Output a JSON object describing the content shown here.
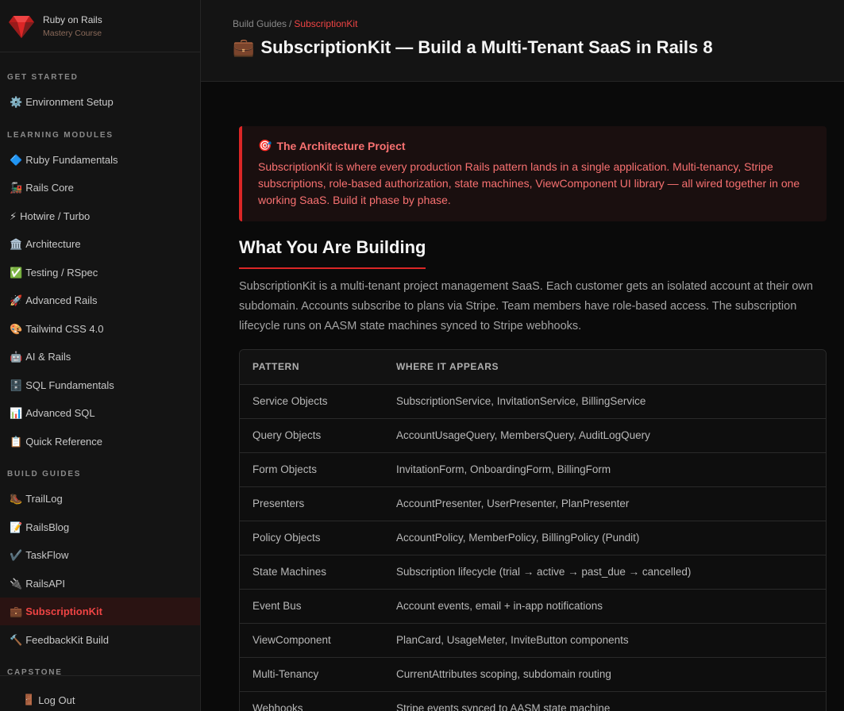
{
  "brand": {
    "title": "Ruby on Rails",
    "subtitle": "Mastery Course",
    "logo_icon": "ruby-gem-icon",
    "accent": "#dc2626"
  },
  "sidebar": {
    "sections": [
      {
        "label": "GET STARTED"
      },
      {
        "label": "LEARNING MODULES"
      },
      {
        "label": "BUILD GUIDES"
      },
      {
        "label": "CAPSTONE"
      }
    ],
    "items": [
      {
        "emoji": "⚙️",
        "label": "Environment Setup"
      },
      {
        "emoji": "🔷",
        "label": "Ruby Fundamentals"
      },
      {
        "emoji": "🚂",
        "label": "Rails Core"
      },
      {
        "emoji": "⚡",
        "label": "Hotwire / Turbo"
      },
      {
        "emoji": "🏛️",
        "label": "Architecture"
      },
      {
        "emoji": "✅",
        "label": "Testing / RSpec"
      },
      {
        "emoji": "🚀",
        "label": "Advanced Rails"
      },
      {
        "emoji": "🎨",
        "label": "Tailwind CSS 4.0"
      },
      {
        "emoji": "🤖",
        "label": "AI & Rails"
      },
      {
        "emoji": "🗄️",
        "label": "SQL Fundamentals"
      },
      {
        "emoji": "📊",
        "label": "Advanced SQL"
      },
      {
        "emoji": "📋",
        "label": "Quick Reference"
      },
      {
        "emoji": "🥾",
        "label": "TrailLog"
      },
      {
        "emoji": "📝",
        "label": "RailsBlog"
      },
      {
        "emoji": "✔️",
        "label": "TaskFlow"
      },
      {
        "emoji": "🔌",
        "label": "RailsAPI"
      },
      {
        "emoji": "💼",
        "label": "SubscriptionKit",
        "active": true
      },
      {
        "emoji": "🔨",
        "label": "FeedbackKit Build"
      }
    ],
    "logout": {
      "emoji": "🚪",
      "label": "Log Out"
    }
  },
  "header": {
    "breadcrumb": {
      "parent": "Build Guides",
      "separator": "/",
      "current": "SubscriptionKit"
    },
    "title_emoji": "💼",
    "title": "SubscriptionKit — Build a Multi-Tenant SaaS in Rails 8"
  },
  "callout": {
    "emoji": "🎯",
    "title": "The Architecture Project",
    "body": "SubscriptionKit is where every production Rails pattern lands in a single application. Multi-tenancy, Stripe subscriptions, role-based authorization, state machines, ViewComponent UI library — all wired together in one working SaaS. Build it phase by phase."
  },
  "section": {
    "heading": "What You Are Building",
    "intro": "SubscriptionKit is a multi-tenant project management SaaS. Each customer gets an isolated account at their own subdomain. Accounts subscribe to plans via Stripe. Team members have role-based access. The subscription lifecycle runs on AASM state machines synced to Stripe webhooks."
  },
  "table": {
    "headers": [
      "PATTERN",
      "WHERE IT APPEARS"
    ],
    "rows": [
      [
        "Service Objects",
        "SubscriptionService, InvitationService, BillingService"
      ],
      [
        "Query Objects",
        "AccountUsageQuery, MembersQuery, AuditLogQuery"
      ],
      [
        "Form Objects",
        "InvitationForm, OnboardingForm, BillingForm"
      ],
      [
        "Presenters",
        "AccountPresenter, UserPresenter, PlanPresenter"
      ],
      [
        "Policy Objects",
        "AccountPolicy, MemberPolicy, BillingPolicy (Pundit)"
      ],
      [
        "State Machines",
        "Subscription lifecycle (trial → active → past_due → cancelled)"
      ],
      [
        "Event Bus",
        "Account events, email + in-app notifications"
      ],
      [
        "ViewComponent",
        "PlanCard, UsageMeter, InviteButton components"
      ],
      [
        "Multi-Tenancy",
        "CurrentAttributes scoping, subdomain routing"
      ],
      [
        "Webhooks",
        "Stripe events synced to AASM state machine"
      ]
    ]
  }
}
